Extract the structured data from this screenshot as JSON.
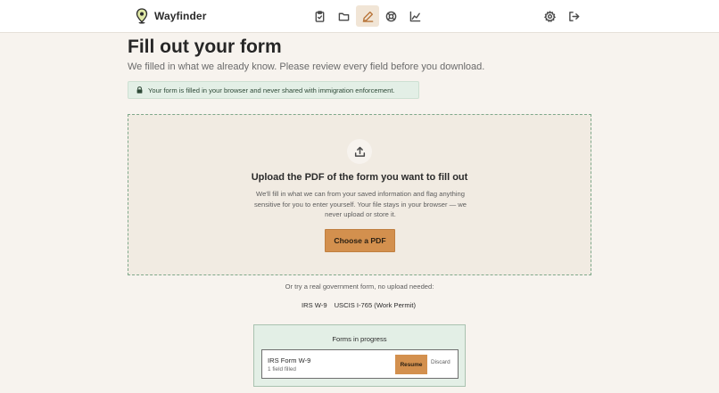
{
  "app": {
    "name": "Wayfinder",
    "accent": "#d3904e"
  },
  "nav": {
    "items": [
      {
        "icon": "clipboard-icon",
        "active": false
      },
      {
        "icon": "folder-icon",
        "active": false
      },
      {
        "icon": "pencil-icon",
        "active": true
      },
      {
        "icon": "lifebuoy-icon",
        "active": false
      },
      {
        "icon": "chart-line-icon",
        "active": false
      }
    ],
    "right": [
      {
        "icon": "gear-icon"
      },
      {
        "icon": "sign-out-icon"
      }
    ]
  },
  "header": {
    "title": "Fill out your form",
    "subtitle": "We filled in what we already know. Please review every field before you download."
  },
  "privacy": {
    "text": "Your form is filled in your browser and never shared with immigration enforcement."
  },
  "upload": {
    "title": "Upload the PDF of the form you want to fill out",
    "description": "We'll fill in what we can from your saved information and flag anything sensitive for you to enter yourself. Your file stays in your browser — we never upload or store it.",
    "button_label": "Choose a PDF"
  },
  "samples": {
    "intro": "Or try a real government form, no upload needed:",
    "links": [
      "IRS W-9",
      "USCIS I-765 (Work Permit)"
    ]
  },
  "in_progress": {
    "title": "Forms in progress",
    "items": [
      {
        "name": "IRS Form W-9",
        "status": "1 field filled",
        "resume_label": "Resume",
        "discard_label": "Discard"
      }
    ]
  }
}
